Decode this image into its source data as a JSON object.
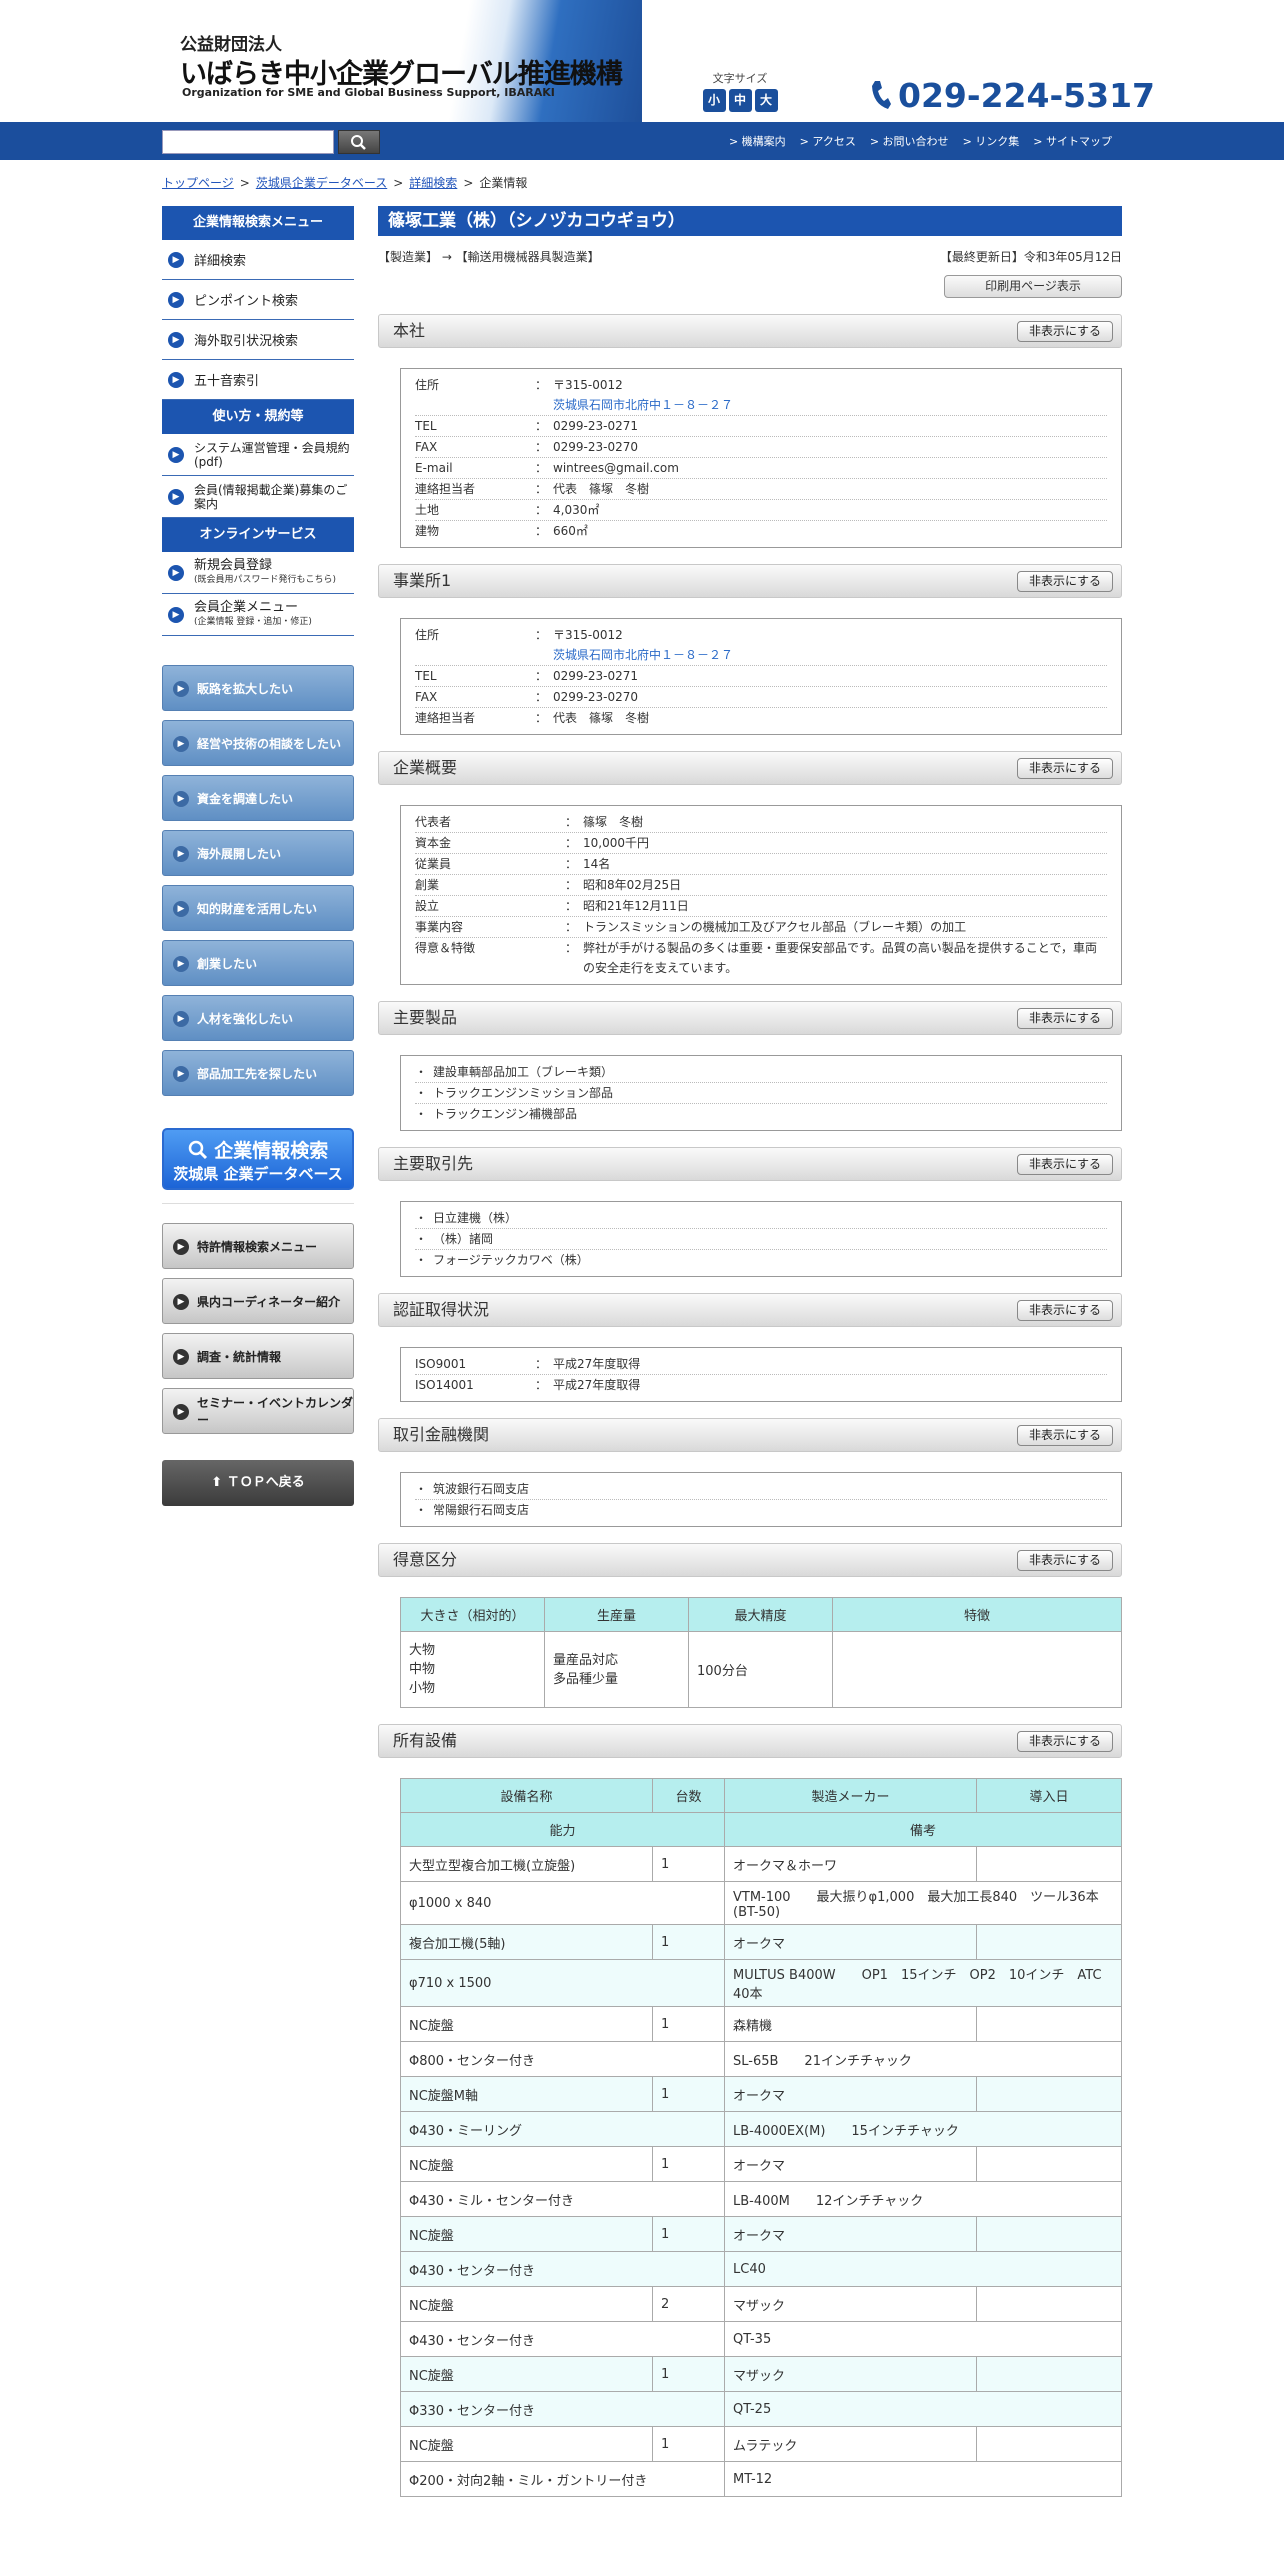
{
  "header": {
    "logo_line1": "公益財団法人",
    "logo_line2": "いばらき中小企業グローバル推進機構",
    "logo_line3": "Organization for SME and Global Business Support, IBARAKI",
    "font_size_label": "文字サイズ",
    "font_sizes": [
      "小",
      "中",
      "大"
    ],
    "phone": "029-224-5317",
    "nav": [
      "> 機構案内",
      "> アクセス",
      "> お問い合わせ",
      "> リンク集",
      "> サイトマップ"
    ]
  },
  "breadcrumb": [
    "トップページ",
    "茨城県企業データベース",
    "詳細検索",
    "企業情報"
  ],
  "sidebar": {
    "menu_title": "企業情報検索メニュー",
    "menu_items": [
      "詳細検索",
      "ピンポイント検索",
      "海外取引状況検索",
      "五十音索引"
    ],
    "rules_title": "使い方・規約等",
    "rules_items": [
      {
        "label": "システム運営管理・会員規約(pdf)"
      },
      {
        "label": "会員(情報掲載企業)募集のご案内"
      }
    ],
    "online_title": "オンラインサービス",
    "online_items": [
      {
        "label": "新規会員登録",
        "sub": "(既会員用パスワード発行もこちら)"
      },
      {
        "label": "会員企業メニュー",
        "sub": "(企業情報 登録・追加・修正)"
      }
    ],
    "blue_buttons": [
      "販路を拡大したい",
      "経営や技術の相談をしたい",
      "資金を調達したい",
      "海外展開したい",
      "知的財産を活用したい",
      "創業したい",
      "人材を強化したい",
      "部品加工先を探したい"
    ],
    "db_banner_line1": "企業情報検索",
    "db_banner_line2": "茨城県 企業データベース",
    "gray_buttons": [
      "特許情報検索メニュー",
      "県内コーディネーター紹介",
      "調査・統計情報",
      "セミナー・イベントカレンダー"
    ],
    "top_button": "ＴＯＰへ戻る"
  },
  "company": {
    "name": "篠塚工業（株）（シノヅカコウギョウ）",
    "category": "【製造業】 → 【輸送用機械器具製造業】",
    "updated": "【最終更新日】令和3年05月12日",
    "print_button": "印刷用ページ表示",
    "hide_label": "非表示にする"
  },
  "honsha": {
    "title": "本社",
    "rows": [
      {
        "k": "住所",
        "v": "〒315-0012",
        "v2": "茨城県石岡市北府中１－８－２７"
      },
      {
        "k": "TEL",
        "v": "0299-23-0271"
      },
      {
        "k": "FAX",
        "v": "0299-23-0270"
      },
      {
        "k": "E-mail",
        "v": "wintrees@gmail.com"
      },
      {
        "k": "連絡担当者",
        "v": "代表　篠塚　冬樹"
      },
      {
        "k": "土地",
        "v": "4,030㎡"
      },
      {
        "k": "建物",
        "v": "660㎡"
      }
    ]
  },
  "office": {
    "title": "事業所1",
    "rows": [
      {
        "k": "住所",
        "v": "〒315-0012",
        "v2": "茨城県石岡市北府中１－８－２７"
      },
      {
        "k": "TEL",
        "v": "0299-23-0271"
      },
      {
        "k": "FAX",
        "v": "0299-23-0270"
      },
      {
        "k": "連絡担当者",
        "v": "代表　篠塚　冬樹"
      }
    ]
  },
  "overview": {
    "title": "企業概要",
    "rows": [
      {
        "k": "代表者",
        "v": "篠塚　冬樹"
      },
      {
        "k": "資本金",
        "v": "10,000千円"
      },
      {
        "k": "従業員",
        "v": "14名"
      },
      {
        "k": "創業",
        "v": "昭和8年02月25日"
      },
      {
        "k": "設立",
        "v": "昭和21年12月11日"
      },
      {
        "k": "事業内容",
        "v": "トランスミッションの機械加工及びアクセル部品（ブレーキ類）の加工"
      },
      {
        "k": "得意＆特徴",
        "v": "弊社が手がける製品の多くは重要・重要保安部品です。品質の高い製品を提供することで，車両の安全走行を支えています。"
      }
    ]
  },
  "products": {
    "title": "主要製品",
    "items": [
      "建設車輌部品加工（ブレーキ類）",
      "トラックエンジンミッション部品",
      "トラックエンジン補機部品"
    ]
  },
  "customers": {
    "title": "主要取引先",
    "items": [
      "日立建機（株）",
      "（株）諸岡",
      "フォージテックカワベ（株）"
    ]
  },
  "certs": {
    "title": "認証取得状況",
    "rows": [
      {
        "k": "ISO9001",
        "v": "平成27年度取得"
      },
      {
        "k": "ISO14001",
        "v": "平成27年度取得"
      }
    ]
  },
  "banks": {
    "title": "取引金融機関",
    "items": [
      "筑波銀行石岡支店",
      "常陽銀行石岡支店"
    ]
  },
  "specialty": {
    "title": "得意区分",
    "headers": [
      "大きさ（相対的）",
      "生産量",
      "最大精度",
      "特徴"
    ],
    "size": "大物\n中物\n小物",
    "volume": "量産品対応\n多品種少量",
    "precision": "100分台",
    "feature": ""
  },
  "equipment": {
    "title": "所有設備",
    "headers": [
      "設備名称",
      "台数",
      "製造メーカー",
      "導入日"
    ],
    "headers2": [
      "能力",
      "備考"
    ],
    "rows": [
      {
        "name": "大型立型複合加工機(立旋盤)",
        "qty": "1",
        "maker": "オークマ＆ホーワ",
        "date": "",
        "cap": "φ1000 x 840",
        "note": "VTM-100　　最大振りφ1,000　最大加工長840　ツール36本(BT-50)"
      },
      {
        "name": "複合加工機(5軸)",
        "qty": "1",
        "maker": "オークマ",
        "date": "",
        "cap": "φ710 x 1500",
        "note": "MULTUS B400W　　OP1　15インチ　OP2　10インチ　ATC　40本"
      },
      {
        "name": "NC旋盤",
        "qty": "1",
        "maker": "森精機",
        "date": "",
        "cap": "Φ800・センター付き",
        "note": "SL-65B　　21インチチャック"
      },
      {
        "name": "NC旋盤M軸",
        "qty": "1",
        "maker": "オークマ",
        "date": "",
        "cap": "Φ430・ミーリング",
        "note": "LB-4000EX(M)　　15インチチャック"
      },
      {
        "name": "NC旋盤",
        "qty": "1",
        "maker": "オークマ",
        "date": "",
        "cap": "Φ430・ミル・センター付き",
        "note": "LB-400M　　12インチチャック"
      },
      {
        "name": "NC旋盤",
        "qty": "1",
        "maker": "オークマ",
        "date": "",
        "cap": "Φ430・センター付き",
        "note": "LC40"
      },
      {
        "name": "NC旋盤",
        "qty": "2",
        "maker": "マザック",
        "date": "",
        "cap": "Φ430・センター付き",
        "note": "QT-35"
      },
      {
        "name": "NC旋盤",
        "qty": "1",
        "maker": "マザック",
        "date": "",
        "cap": "Φ330・センター付き",
        "note": "QT-25"
      },
      {
        "name": "NC旋盤",
        "qty": "1",
        "maker": "ムラテック",
        "date": "",
        "cap": "Φ200・対向2軸・ミル・ガントリー付き",
        "note": "MT-12"
      }
    ]
  },
  "colors": {
    "brand": "#1c55b0",
    "nav_bar": "#1b4e9d",
    "table_header": "#b6eeee",
    "link": "#2a6ac8"
  }
}
